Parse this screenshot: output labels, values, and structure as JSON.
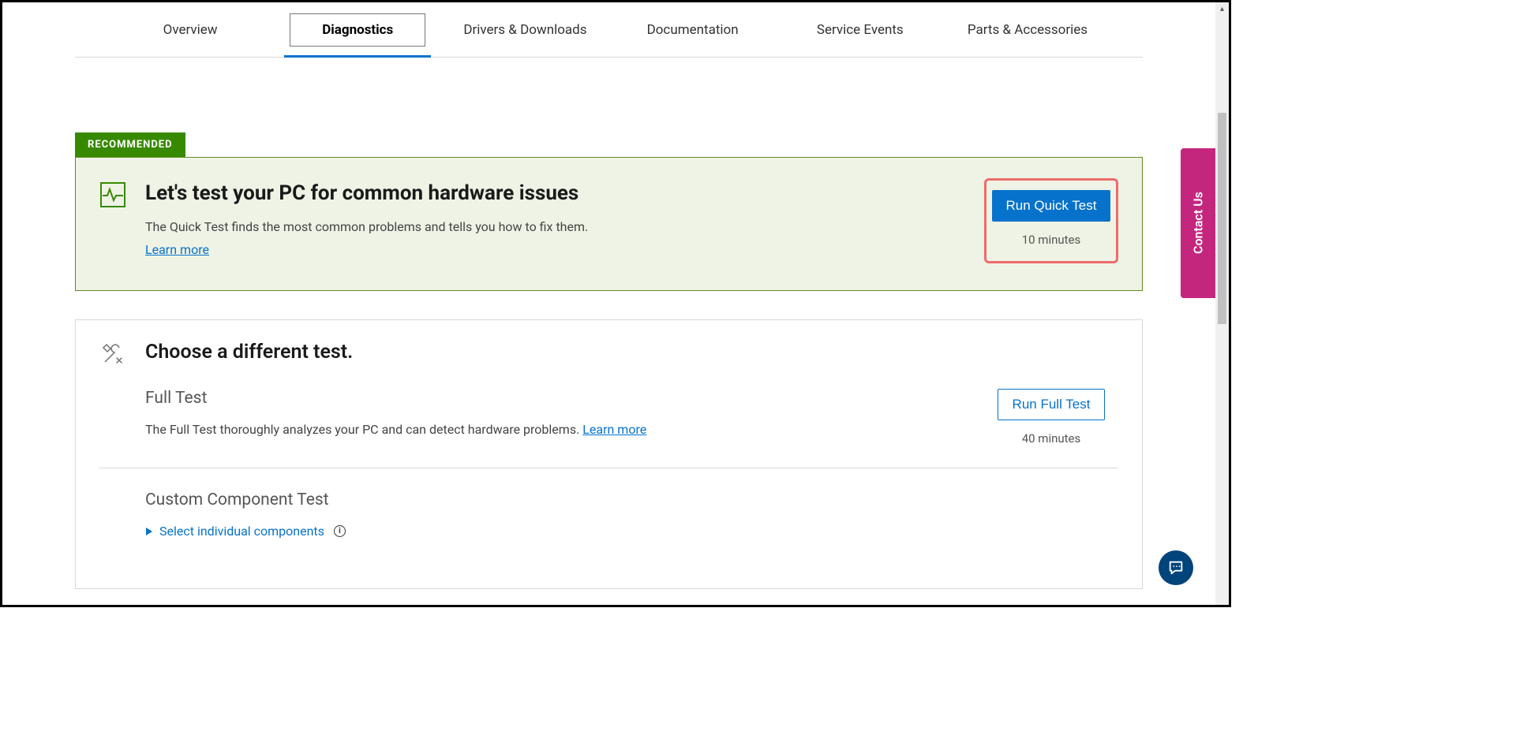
{
  "tabs": {
    "overview": "Overview",
    "diagnostics": "Diagnostics",
    "drivers": "Drivers & Downloads",
    "documentation": "Documentation",
    "service_events": "Service Events",
    "parts": "Parts & Accessories"
  },
  "recommended_badge": "RECOMMENDED",
  "quick_test": {
    "title": "Let's test your PC for common hardware issues",
    "desc": "The Quick Test finds the most common problems and tells you how to fix them.",
    "learn_more": "Learn more",
    "button": "Run Quick Test",
    "duration": "10 minutes"
  },
  "choose_different": {
    "title": "Choose a different test."
  },
  "full_test": {
    "heading": "Full Test",
    "desc": "The Full Test thoroughly analyzes your PC and can detect hardware problems. ",
    "learn_more": "Learn more",
    "button": "Run Full Test",
    "duration": "40 minutes"
  },
  "custom_test": {
    "heading": "Custom Component Test",
    "select_label": "Select individual components"
  },
  "contact_us": "Contact Us"
}
